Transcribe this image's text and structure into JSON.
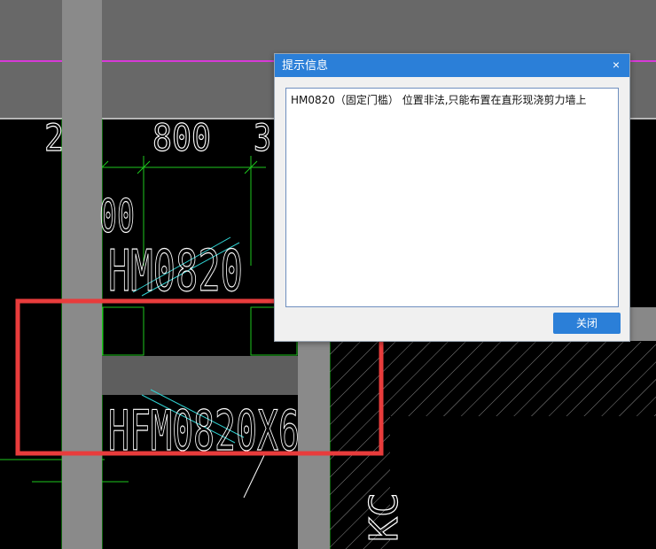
{
  "cad": {
    "dim_top_1": "2",
    "dim_top_2": "800",
    "dim_top_3": "3",
    "dim_left": "00",
    "label_hm": "HM0820",
    "label_hfm": "HFM0820X6",
    "label_right": "KC"
  },
  "dialog": {
    "title": "提示信息",
    "close_icon": "×",
    "message": "HM0820（固定门槛） 位置非法,只能布置在直形现浇剪力墙上",
    "close_button": "关闭"
  },
  "colors": {
    "titlebar": "#2b7fd8",
    "highlight_box": "#e83c3c",
    "magenta_axis": "#d83ad8",
    "dim_lines": "#1ec81e",
    "hatch": "#2fd0d0"
  }
}
